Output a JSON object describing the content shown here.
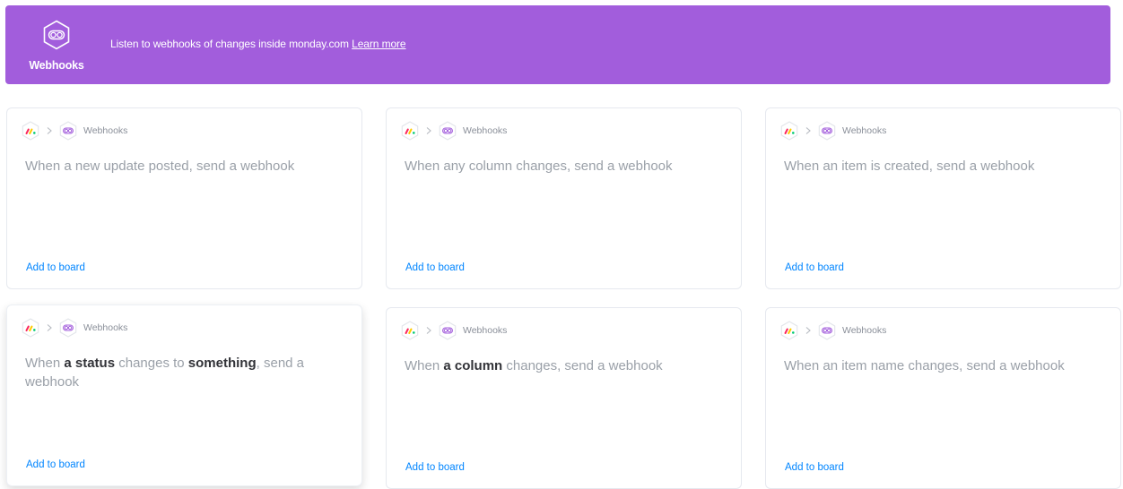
{
  "banner": {
    "app_name": "Webhooks",
    "description": "Listen to webhooks of changes inside monday.com ",
    "learn_more": "Learn more",
    "color": "#a25ddc"
  },
  "cards": [
    {
      "breadcrumb": "Webhooks",
      "recipe": [
        "When a new update posted, send a webhook"
      ],
      "action": "Add to board"
    },
    {
      "breadcrumb": "Webhooks",
      "recipe": [
        "When any column changes, send a webhook"
      ],
      "action": "Add to board"
    },
    {
      "breadcrumb": "Webhooks",
      "recipe": [
        "When an item is created, send a webhook"
      ],
      "action": "Add to board"
    },
    {
      "breadcrumb": "Webhooks",
      "recipe": [
        "When ",
        "a status",
        " changes to ",
        "something",
        ", send a webhook"
      ],
      "action": "Add to board"
    },
    {
      "breadcrumb": "Webhooks",
      "recipe": [
        "When ",
        "a column",
        " changes, send a webhook"
      ],
      "action": "Add to board"
    },
    {
      "breadcrumb": "Webhooks",
      "recipe": [
        "When an item name changes, send a webhook"
      ],
      "action": "Add to board"
    }
  ],
  "icons": {
    "monday_logo": "monday-logo-icon",
    "chevron": "chevron-right-icon",
    "webhooks": "webhooks-icon"
  },
  "colors": {
    "link": "#0085ff",
    "recipe_text": "#9aa0a8",
    "recipe_emphasis": "#323338"
  }
}
